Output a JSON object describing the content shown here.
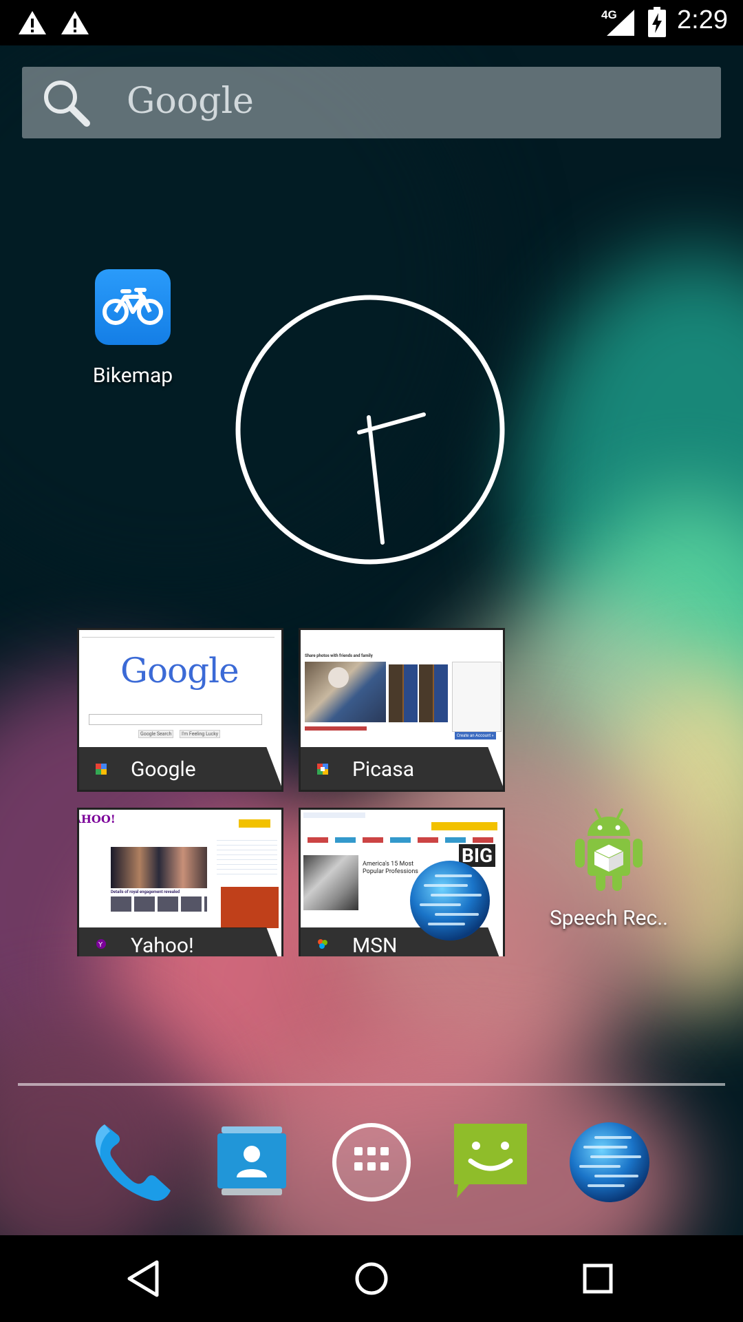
{
  "status_bar": {
    "time": "2:29",
    "network": "4G",
    "icons": [
      "warning-icon",
      "warning-icon",
      "signal-icon",
      "battery-charging-icon"
    ]
  },
  "search": {
    "placeholder": "Google",
    "icon": "search-icon"
  },
  "apps": [
    {
      "label": "Bikemap",
      "icon": "bicycle-icon"
    },
    {
      "label": "Speech Rec..",
      "icon": "android-robot-icon"
    }
  ],
  "bookmarks": [
    {
      "title": "Google"
    },
    {
      "title": "Picasa"
    },
    {
      "title": "Yahoo!"
    },
    {
      "title": "MSN"
    }
  ],
  "thumbnails": {
    "google_logo": "Google",
    "google_btn1": "Google Search",
    "google_btn2": "I'm Feeling Lucky",
    "picasa_header": "Share photos with friends and family",
    "picasa_button": "Create an Account »",
    "yahoo_logo": "YAHOO!",
    "yahoo_headline": "Details of royal engagement revealed",
    "msn_headline": "America's 15 Most Popular Professions",
    "msn_big": "BIG"
  },
  "dock": [
    {
      "name": "phone",
      "icon": "phone-icon"
    },
    {
      "name": "contacts",
      "icon": "contacts-icon"
    },
    {
      "name": "app-drawer",
      "icon": "app-drawer-icon"
    },
    {
      "name": "messaging",
      "icon": "messaging-icon"
    },
    {
      "name": "browser",
      "icon": "globe-icon"
    }
  ],
  "nav": [
    "back-icon",
    "home-icon",
    "recents-icon"
  ],
  "colors": {
    "search_bg": "#8a969b",
    "bikemap_blue": "#1e8ff5",
    "android_green": "#86c440",
    "messaging_green": "#8fbd2a",
    "contacts_blue": "#2196d8",
    "phone_blue": "#1b9ce8"
  }
}
